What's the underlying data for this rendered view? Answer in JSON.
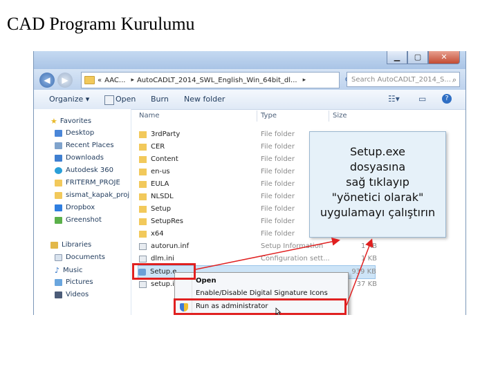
{
  "slide": {
    "title": "CAD Programı Kurulumu"
  },
  "window": {
    "buttons": {
      "minimize": "▁",
      "maximize": "▢",
      "close": "✕"
    }
  },
  "address": {
    "back_glyph": "◀",
    "forward_glyph": "▶",
    "parts": [
      "«",
      "AAC...",
      "▸",
      "AutoCADLT_2014_SWL_English_Win_64bit_dl...",
      "▸"
    ],
    "search_placeholder": "Search AutoCADLT_2014_S..."
  },
  "toolbar": {
    "organize": "Organize ▾",
    "open": "Open",
    "burn": "Burn",
    "new_folder": "New folder"
  },
  "nav": {
    "favorites_header": "Favorites",
    "favorites": [
      "Desktop",
      "Recent Places",
      "Downloads",
      "Autodesk 360",
      "FRITERM_PROJE",
      "sismat_kapak_proj",
      "Dropbox",
      "Greenshot"
    ],
    "libraries_header": "Libraries",
    "libraries": [
      "Documents",
      "Music",
      "Pictures",
      "Videos"
    ]
  },
  "columns": {
    "name": "Name",
    "type": "Type",
    "size": "Size"
  },
  "files": [
    {
      "name": "3rdParty",
      "type": "File folder",
      "size": ""
    },
    {
      "name": "CER",
      "type": "File folder",
      "size": ""
    },
    {
      "name": "Content",
      "type": "File folder",
      "size": ""
    },
    {
      "name": "en-us",
      "type": "File folder",
      "size": ""
    },
    {
      "name": "EULA",
      "type": "File folder",
      "size": ""
    },
    {
      "name": "NLSDL",
      "type": "File folder",
      "size": ""
    },
    {
      "name": "Setup",
      "type": "File folder",
      "size": ""
    },
    {
      "name": "SetupRes",
      "type": "File folder",
      "size": ""
    },
    {
      "name": "x64",
      "type": "File folder",
      "size": ""
    },
    {
      "name": "autorun.inf",
      "type": "Setup Information",
      "size": "1 KB"
    },
    {
      "name": "dlm.ini",
      "type": "Configuration sett...",
      "size": "1 KB"
    },
    {
      "name": "Setup.e",
      "type": "",
      "size": "939 KB"
    },
    {
      "name": "setup.ir",
      "type": "",
      "size": "37 KB"
    }
  ],
  "callout": {
    "lines": [
      "Setup.exe",
      "dosyasına",
      "sağ tıklayıp",
      "\"yönetici olarak\"",
      "uygulamayı çalıştırın"
    ]
  },
  "context_menu": {
    "open": "Open",
    "signature": "Enable/Disable Digital Signature Icons",
    "run_as_admin": "Run as administrator"
  },
  "colors": {
    "highlight": "#e02020",
    "folder": "#f2c95b",
    "selection": "#cde4f7"
  }
}
